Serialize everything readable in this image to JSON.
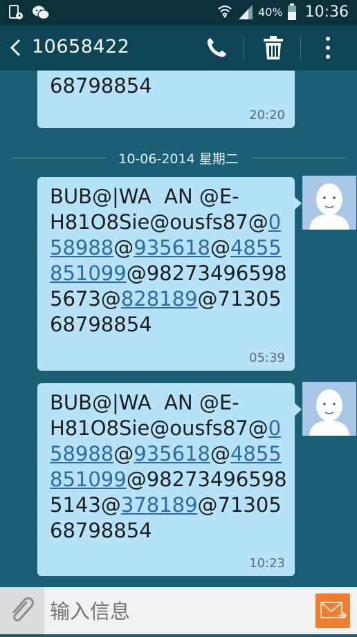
{
  "status_bar": {
    "battery_percent": "40%",
    "time": "10:36",
    "icons": [
      "sim-icon",
      "wechat-icon",
      "wifi-icon",
      "signal-icon",
      "battery-icon"
    ]
  },
  "header": {
    "contact": "10658422"
  },
  "conversation": {
    "partial_message": {
      "tail_text": "68798854",
      "time": "20:20"
    },
    "date_separator": "10-06-2014 星期二",
    "messages": [
      {
        "lines": [
          "BUB@|WA  AN @E-",
          "H81O8Sie@ousfs87@",
          "58988",
          "@",
          "935618",
          "@",
          "4855",
          "851099",
          "@98273496598",
          "5673@",
          "828189",
          "@71305",
          "68798854"
        ],
        "time": "05:39"
      },
      {
        "lines": [
          "BUB@|WA  AN @E-",
          "H81O8Sie@ousfs87@",
          "58988",
          "@",
          "935618",
          "@",
          "4855",
          "851099",
          "@98273496598",
          "5143@",
          "378189",
          "@71305",
          "68798854"
        ],
        "time": "10:23"
      }
    ]
  },
  "compose": {
    "placeholder": "输入信息"
  },
  "colors": {
    "background": "#1c5f74",
    "app_bar": "#0e4556",
    "status_bar": "#0b2f3b",
    "bubble": "#b6e3f7",
    "link": "#2a6ba8",
    "send_button": "#ef7e31"
  }
}
